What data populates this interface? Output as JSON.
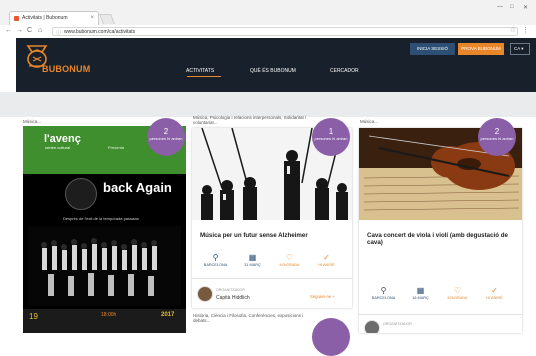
{
  "browser": {
    "tab_title": "Activitats | Bubonum",
    "tab_close": "×",
    "url": "www.bubonum.com/ca/activitats",
    "back": "←",
    "forward": "→",
    "reload": "C",
    "home": "⌂",
    "lock": "ⓘ",
    "star": "☆",
    "menu": "⋮",
    "minimize": "—",
    "maximize": "□",
    "close": "✕"
  },
  "header": {
    "brand": "BUBONUM",
    "login_label": "INICIA SESSIÓ",
    "cta_label": "PROVA BUBONUM",
    "lang_label": "CA ▾",
    "nav": [
      "ACTIVITATS",
      "QUÈ ÉS BUBONUM",
      "CERCADOR"
    ]
  },
  "cards": [
    {
      "category": "Música...",
      "badge_count": "2",
      "badge_text": "persones hi aniran",
      "poster": {
        "venue": "l'avenç",
        "venue_sub": "centre cultural",
        "presents": "Presenta",
        "headline": "back Again",
        "tagline": "Després de l'èxit de la temporada passada",
        "date": "19",
        "hour": "18:00h",
        "year": "2017"
      }
    },
    {
      "category": "Música, Psicologia i relacions interpersonals, Solidaritat i voluntariat...",
      "badge_count": "1",
      "badge_text": "persones hi aniran",
      "title": "Música per un futur sense Alzheimer",
      "meta": [
        {
          "icon": "⚲",
          "label": "BARCELONA"
        },
        {
          "icon": "▦",
          "label": "31 MARÇ"
        },
        {
          "icon": "♡",
          "label": "M'AGRADA"
        },
        {
          "icon": "✓",
          "label": "HI ANIRÉ"
        }
      ],
      "organizer_label": "ORGANITZADOR",
      "organizer_name": "Capità Hiddlich",
      "follow_label": "Segueix-ne +",
      "next_category": "Història, Ciència i Filosofia, Conferències, exposicions i debats..."
    },
    {
      "category": "Música...",
      "badge_count": "2",
      "badge_text": "persones hi aniran",
      "title": "Cava concert de viola i violí (amb degustació de cava)",
      "meta": [
        {
          "icon": "⚲",
          "label": "BARCELONA"
        },
        {
          "icon": "▦",
          "label": "16 MARÇ"
        },
        {
          "icon": "♡",
          "label": "M'AGRADA"
        },
        {
          "icon": "✓",
          "label": "HI ANIRÉ"
        }
      ],
      "organizer_label": "ORGANITZADOR"
    }
  ],
  "colors": {
    "header_bg": "#17202b",
    "accent": "#e8862a",
    "navy": "#2d4f73",
    "badge": "#8b5fa8"
  }
}
